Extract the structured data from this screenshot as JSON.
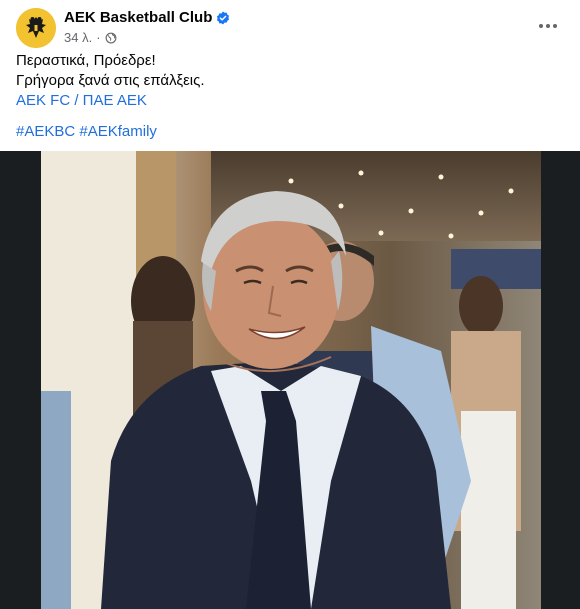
{
  "post": {
    "page_name": "AEK Basketball Club",
    "timestamp": "34 λ.",
    "dot": "·",
    "text_lines": [
      "Περαστικά, Πρόεδρε!",
      "Γρήγορα ξανά στις επάλξεις."
    ],
    "mention": "AEK FC / ΠΑΕ ΑΕΚ",
    "hashtags": [
      "#AEKBC",
      "#AEKfamily"
    ]
  },
  "icons": {
    "verified": "verified-badge-icon",
    "audience": "globe-icon",
    "more": "more-options-icon"
  },
  "colors": {
    "link": "#216fdb",
    "secondary_text": "#65676b",
    "verified_blue": "#1877f2"
  }
}
